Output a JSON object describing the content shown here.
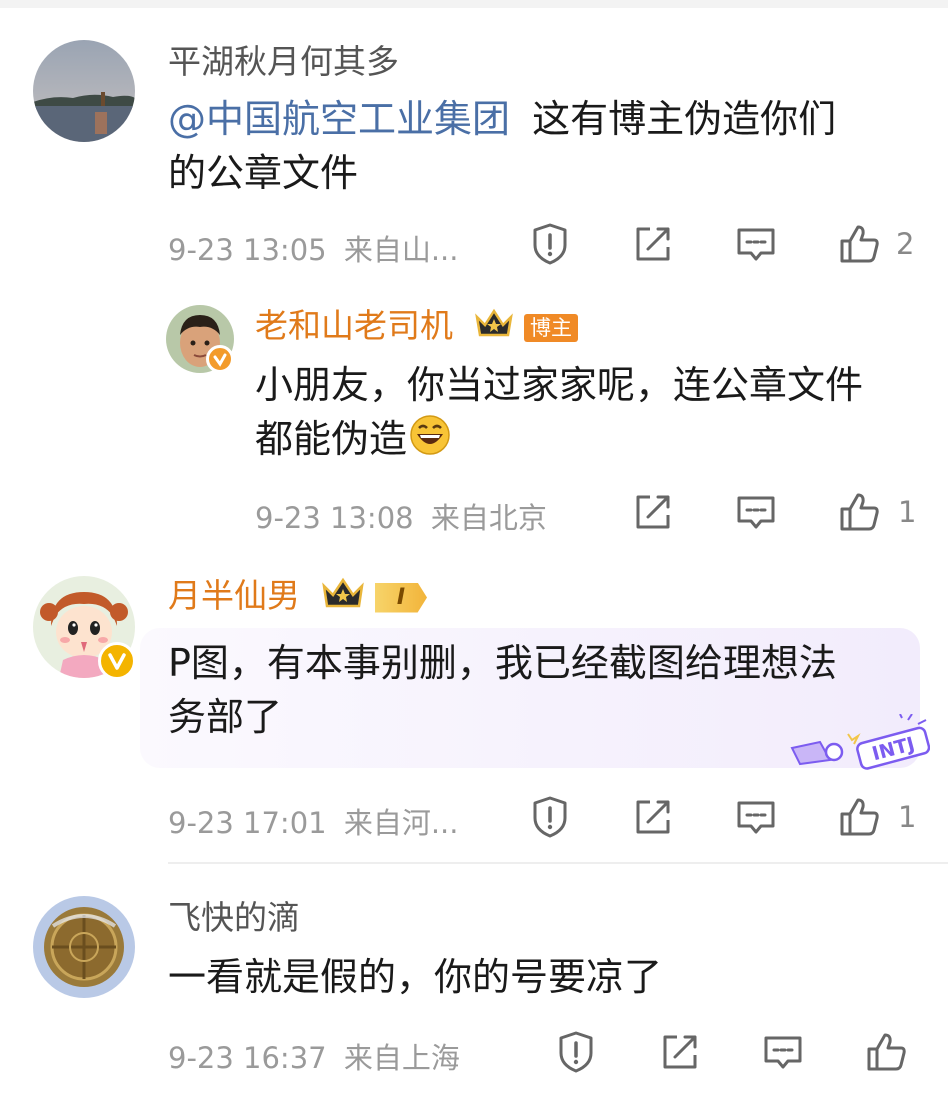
{
  "colors": {
    "mention": "#4a6fa6",
    "vip_name": "#e07a1a",
    "meta": "#9a9a9a",
    "bubble": "#f4effd"
  },
  "comments": [
    {
      "username": "平湖秋月何其多",
      "mention": "@中国航空工业集团",
      "text_line1": "这有博主伪造你们",
      "text_line2": "的公章文件",
      "time": "9-23 13:05",
      "location": "来自山...",
      "likes": "2",
      "icons": [
        "report-icon",
        "share-icon",
        "reply-icon",
        "like-icon"
      ]
    },
    {
      "username": "老和山老司机",
      "badge": "博主",
      "text_line1": "小朋友，你当过家家呢，连公章文件",
      "text_line2": "都能伪造",
      "emoji": "laughing-emoji-icon",
      "time": "9-23 13:08",
      "location": "来自北京",
      "likes": "1"
    },
    {
      "username": "月半仙男",
      "level": "I",
      "text_line1": "P图，有本事别删，我已经截图给理想法",
      "text_line2": "务部了",
      "sticker": "INTJ",
      "time": "9-23 17:01",
      "location": "来自河...",
      "likes": "1"
    },
    {
      "username": "飞快的滴",
      "text_line1": "一看就是假的，你的号要凉了",
      "time": "9-23 16:37",
      "location": "来自上海",
      "likes": ""
    }
  ]
}
